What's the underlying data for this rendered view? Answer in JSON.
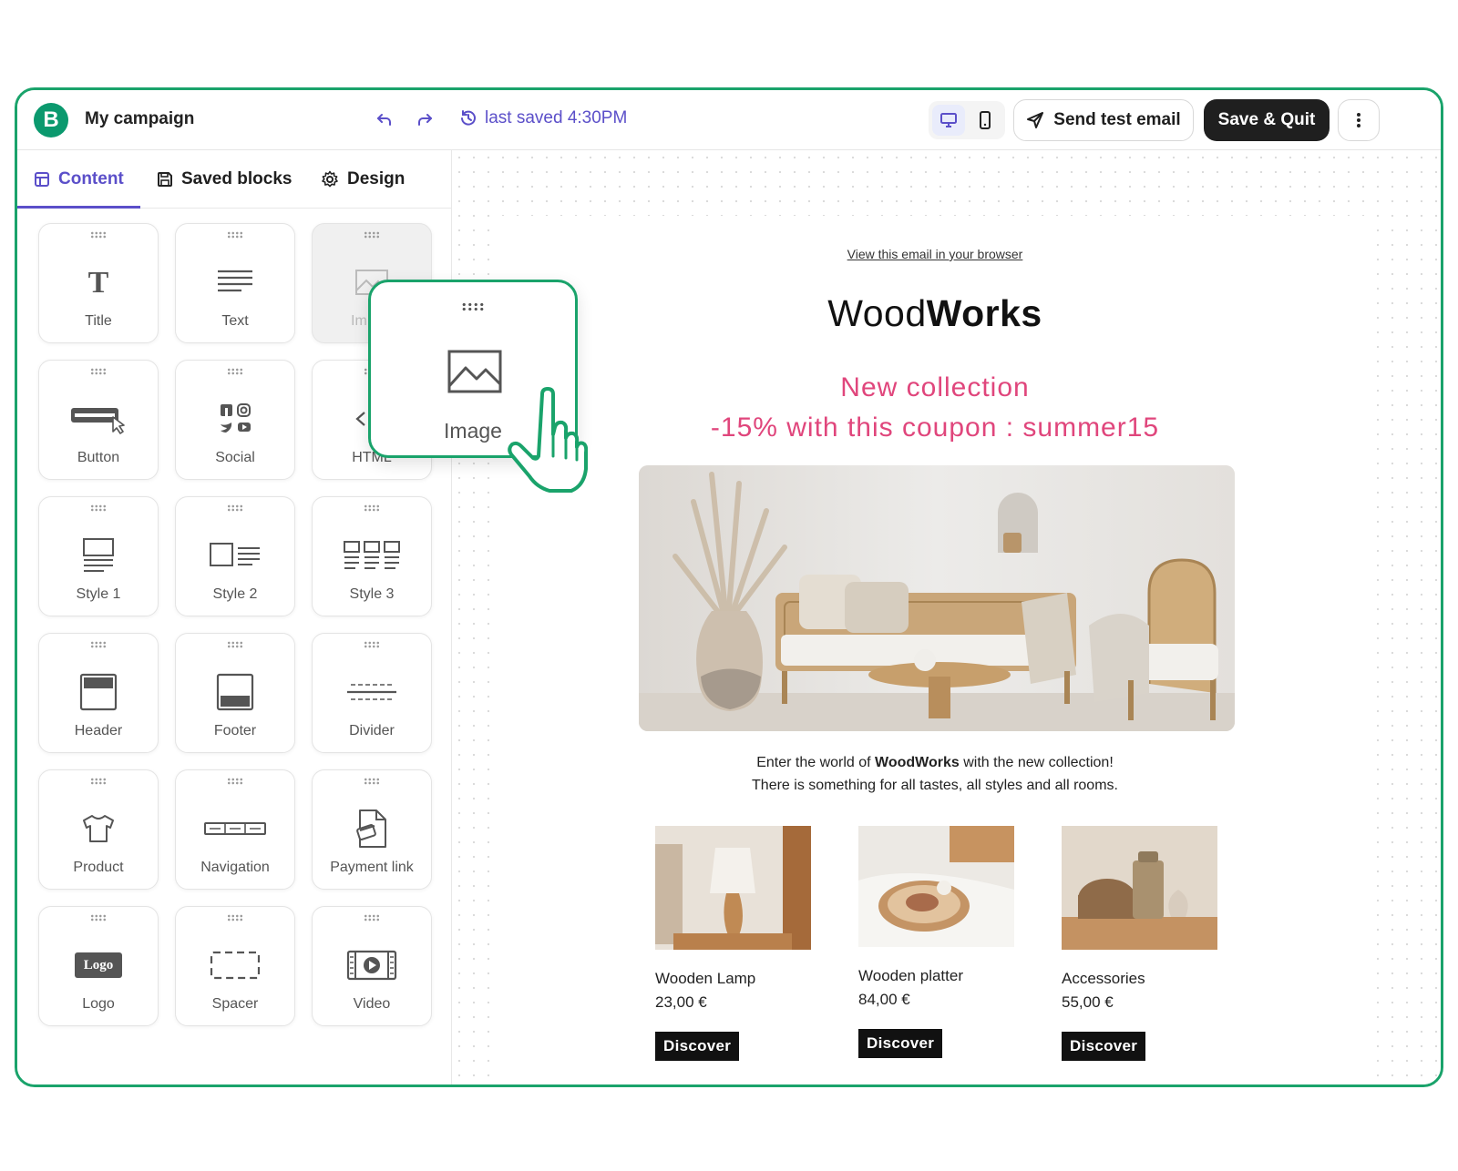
{
  "topbar": {
    "brand_letter": "B",
    "campaign_name": "My campaign",
    "saved_status": "last saved 4:30PM",
    "send_test_label": "Send test email",
    "save_quit_label": "Save & Quit"
  },
  "tabs": [
    {
      "label": "Content",
      "icon": "layout-icon",
      "active": true
    },
    {
      "label": "Saved blocks",
      "icon": "save-icon",
      "active": false
    },
    {
      "label": "Design",
      "icon": "gear-icon",
      "active": false
    }
  ],
  "blocks": [
    {
      "label": "Title",
      "icon": "title-icon"
    },
    {
      "label": "Text",
      "icon": "text-lines-icon"
    },
    {
      "label": "Im",
      "icon": "image-icon"
    },
    {
      "label": "Button",
      "icon": "button-icon"
    },
    {
      "label": "Social",
      "icon": "social-icon"
    },
    {
      "label": "HTML",
      "icon": "html-icon"
    },
    {
      "label": "Style 1",
      "icon": "style1-icon"
    },
    {
      "label": "Style 2",
      "icon": "style2-icon"
    },
    {
      "label": "Style 3",
      "icon": "style3-icon"
    },
    {
      "label": "Header",
      "icon": "header-icon"
    },
    {
      "label": "Footer",
      "icon": "footer-icon"
    },
    {
      "label": "Divider",
      "icon": "divider-icon"
    },
    {
      "label": "Product",
      "icon": "tshirt-icon"
    },
    {
      "label": "Navigation",
      "icon": "navigation-icon"
    },
    {
      "label": "Payment link",
      "icon": "payment-icon"
    },
    {
      "label": "Logo",
      "icon": "logo-icon"
    },
    {
      "label": "Spacer",
      "icon": "spacer-icon"
    },
    {
      "label": "Video",
      "icon": "video-icon"
    }
  ],
  "logo_block_text": "Logo",
  "drag_preview": {
    "label": "Image"
  },
  "email": {
    "view_in_browser": "View this email in your browser",
    "brand_light": "Wood",
    "brand_bold": "Works",
    "promo_line1": "New collection",
    "promo_line2": "-15% with this coupon : summer15",
    "body_line1_pre": "Enter the world of ",
    "body_line1_bold": "WoodWorks",
    "body_line1_post": " with the new collection!",
    "body_line2": "There is something for all tastes, all styles and all rooms.",
    "products": [
      {
        "name": "Wooden Lamp",
        "price": "23,00 €",
        "cta": "Discover"
      },
      {
        "name": "Wooden platter",
        "price": "84,00 €",
        "cta": "Discover"
      },
      {
        "name": "Accessories",
        "price": "55,00 €",
        "cta": "Discover"
      }
    ]
  },
  "colors": {
    "brand_green": "#1aa36b",
    "accent_purple": "#5b4fc9",
    "promo_pink": "#e0467c",
    "dark_button": "#1f1f1f"
  }
}
